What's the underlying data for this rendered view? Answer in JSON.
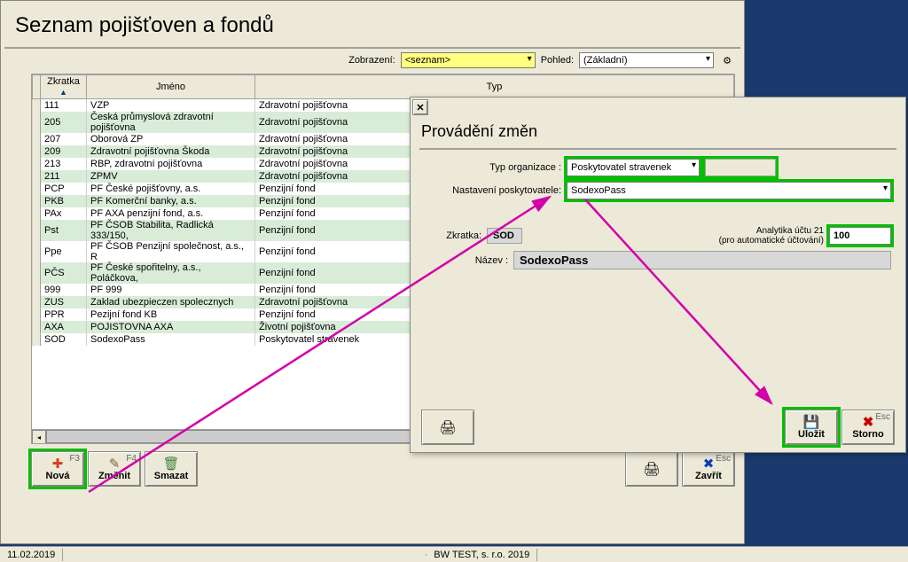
{
  "page_title": "Seznam pojišťoven a fondů",
  "toolbar": {
    "zobrazeni_label": "Zobrazení:",
    "zobrazeni_value": "<seznam>",
    "pohled_label": "Pohled:",
    "pohled_value": "(Základní)"
  },
  "grid": {
    "columns": {
      "zkratka": "Zkratka",
      "jmeno": "Jméno",
      "typ": "Typ"
    },
    "rows": [
      {
        "zk": "111",
        "jm": "VZP",
        "typ": "Zdravotní pojišťovna"
      },
      {
        "zk": "205",
        "jm": "Česká průmyslová zdravotní pojišťovna",
        "typ": "Zdravotní pojišťovna"
      },
      {
        "zk": "207",
        "jm": "Oborová ZP",
        "typ": "Zdravotní pojišťovna"
      },
      {
        "zk": "209",
        "jm": "Zdravotní pojišťovna Škoda",
        "typ": "Zdravotní pojišťovna"
      },
      {
        "zk": "213",
        "jm": "RBP, zdravotní pojišťovna",
        "typ": "Zdravotní pojišťovna"
      },
      {
        "zk": "211",
        "jm": "ZPMV",
        "typ": "Zdravotní pojišťovna"
      },
      {
        "zk": "PCP",
        "jm": "PF České pojišťovny, a.s.",
        "typ": "Penzijní fond"
      },
      {
        "zk": "PKB",
        "jm": "PF Komerční banky, a.s.",
        "typ": "Penzijní fond"
      },
      {
        "zk": "PAx",
        "jm": "PF AXA penzijní fond, a.s.",
        "typ": "Penzijní fond"
      },
      {
        "zk": "Pst",
        "jm": "PF ČSOB Stabilita, Radlická 333/150,",
        "typ": "Penzijní fond"
      },
      {
        "zk": "Ppe",
        "jm": "PF ČSOB Penzijní společnost, a.s., R",
        "typ": "Penzijní fond"
      },
      {
        "zk": "PČS",
        "jm": "PF České spořitelny, a.s., Poláčkova,",
        "typ": "Penzijní fond"
      },
      {
        "zk": "999",
        "jm": "PF 999",
        "typ": "Penzijní fond"
      },
      {
        "zk": "ZUS",
        "jm": "Zaklad ubezpieczen spolecznych",
        "typ": "Zdravotní pojišťovna"
      },
      {
        "zk": "PPR",
        "jm": "Pezijní fond KB",
        "typ": "Penzijní fond"
      },
      {
        "zk": "AXA",
        "jm": "POJISTOVNA AXA",
        "typ": "Životní pojišťovna"
      },
      {
        "zk": "SOD",
        "jm": "SodexoPass",
        "typ": "Poskytovatel stravenek"
      }
    ]
  },
  "buttons": {
    "nova": "Nová",
    "nova_key": "F3",
    "zmenit": "Změnit",
    "zmenit_key": "F4",
    "smazat": "Smazat",
    "zavrit": "Zavřít",
    "zavrit_key": "Esc"
  },
  "dialog": {
    "title": "Provádění změn",
    "typ_org_label": "Typ organizace :",
    "typ_org_value": "Poskytovatel stravenek",
    "nastaveni_label": "Nastavení poskytovatele:",
    "nastaveni_value": "SodexoPass",
    "zkratka_label": "Zkratka:",
    "zkratka_value": "SOD",
    "analytika_label_1": "Analytika účtu 21",
    "analytika_label_2": "(pro automatické účtování)",
    "analytika_value": "100",
    "nazev_label": "Název :",
    "nazev_value": "SodexoPass",
    "ulozit": "Uložit",
    "storno": "Storno",
    "storno_key": "Esc"
  },
  "status": {
    "date": "11.02.2019",
    "company": "BW TEST, s. r.o.  2019"
  }
}
